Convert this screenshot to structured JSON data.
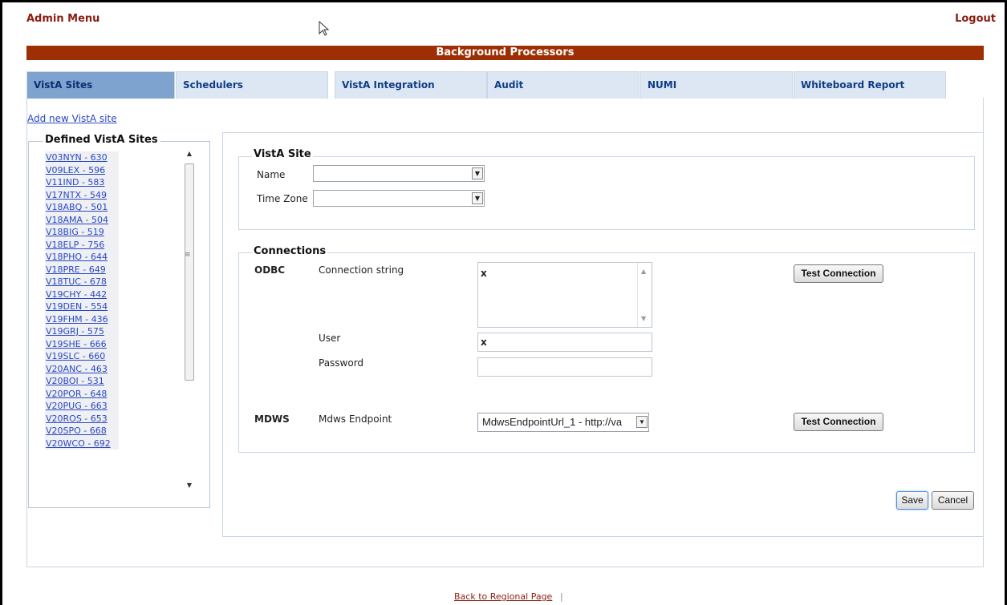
{
  "header": {
    "admin_menu": "Admin Menu",
    "logout": "Logout",
    "title": "Background Processors"
  },
  "tabs": [
    {
      "label": "VistA Sites",
      "active": true
    },
    {
      "label": "Schedulers"
    },
    {
      "label": "VistA Integration"
    },
    {
      "label": "Audit"
    },
    {
      "label": "NUMI"
    },
    {
      "label": "Whiteboard Report"
    }
  ],
  "sidebar": {
    "add_link": "Add new VistA site",
    "legend": "Defined VistA Sites",
    "sites": [
      "V03NYN - 630",
      "V09LEX - 596",
      "V11IND - 583",
      "V17NTX - 549",
      "V18ABQ - 501",
      "V18AMA - 504",
      "V18BIG - 519",
      "V18ELP - 756",
      "V18PHO - 644",
      "V18PRE - 649",
      "V18TUC - 678",
      "V19CHY - 442",
      "V19DEN - 554",
      "V19FHM - 436",
      "V19GRJ - 575",
      "V19SHE - 666",
      "V19SLC - 660",
      "V20ANC - 463",
      "V20BOI - 531",
      "V20POR - 648",
      "V20PUG - 663",
      "V20ROS - 653",
      "V20SPO - 668",
      "V20WCO - 692"
    ]
  },
  "vista_site": {
    "legend": "VistA Site",
    "name_label": "Name",
    "name_value": "",
    "timezone_label": "Time Zone",
    "timezone_value": ""
  },
  "connections": {
    "legend": "Connections",
    "odbc": {
      "label": "ODBC",
      "conn_string_label": "Connection string",
      "conn_string_value": "x",
      "user_label": "User",
      "user_value": "x",
      "password_label": "Password",
      "password_value": "",
      "test_button": "Test Connection"
    },
    "mdws": {
      "label": "MDWS",
      "endpoint_label": "Mdws Endpoint",
      "endpoint_value": "MdwsEndpointUrl_1 - http://va",
      "test_button": "Test Connection"
    }
  },
  "actions": {
    "save": "Save",
    "cancel": "Cancel"
  },
  "footer": {
    "back_link": "Back to Regional Page",
    "separator": "|"
  }
}
